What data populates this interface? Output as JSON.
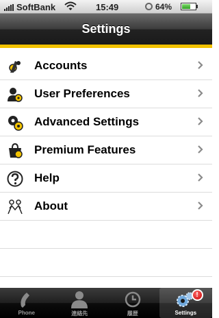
{
  "status_bar": {
    "carrier": "SoftBank",
    "time": "15:49",
    "battery_percent": "64%",
    "battery_level": 0.64
  },
  "nav": {
    "title": "Settings"
  },
  "list": {
    "items": [
      {
        "label": "Accounts",
        "icon": "accounts-icon"
      },
      {
        "label": "User Preferences",
        "icon": "user-preferences-icon"
      },
      {
        "label": "Advanced Settings",
        "icon": "advanced-settings-icon"
      },
      {
        "label": "Premium Features",
        "icon": "premium-features-icon"
      },
      {
        "label": "Help",
        "icon": "help-icon"
      },
      {
        "label": "About",
        "icon": "about-icon"
      }
    ]
  },
  "tabs": [
    {
      "label": "Phone",
      "icon": "phone-icon"
    },
    {
      "label": "連絡先",
      "icon": "contacts-icon"
    },
    {
      "label": "履歴",
      "icon": "history-clock-icon"
    },
    {
      "label": "Settings",
      "icon": "settings-gear-icon",
      "selected": true,
      "badge": "!"
    }
  ],
  "colors": {
    "accent": "#f2c200",
    "nav_dark": "#1a1a1a",
    "badge_red": "#c40000"
  }
}
